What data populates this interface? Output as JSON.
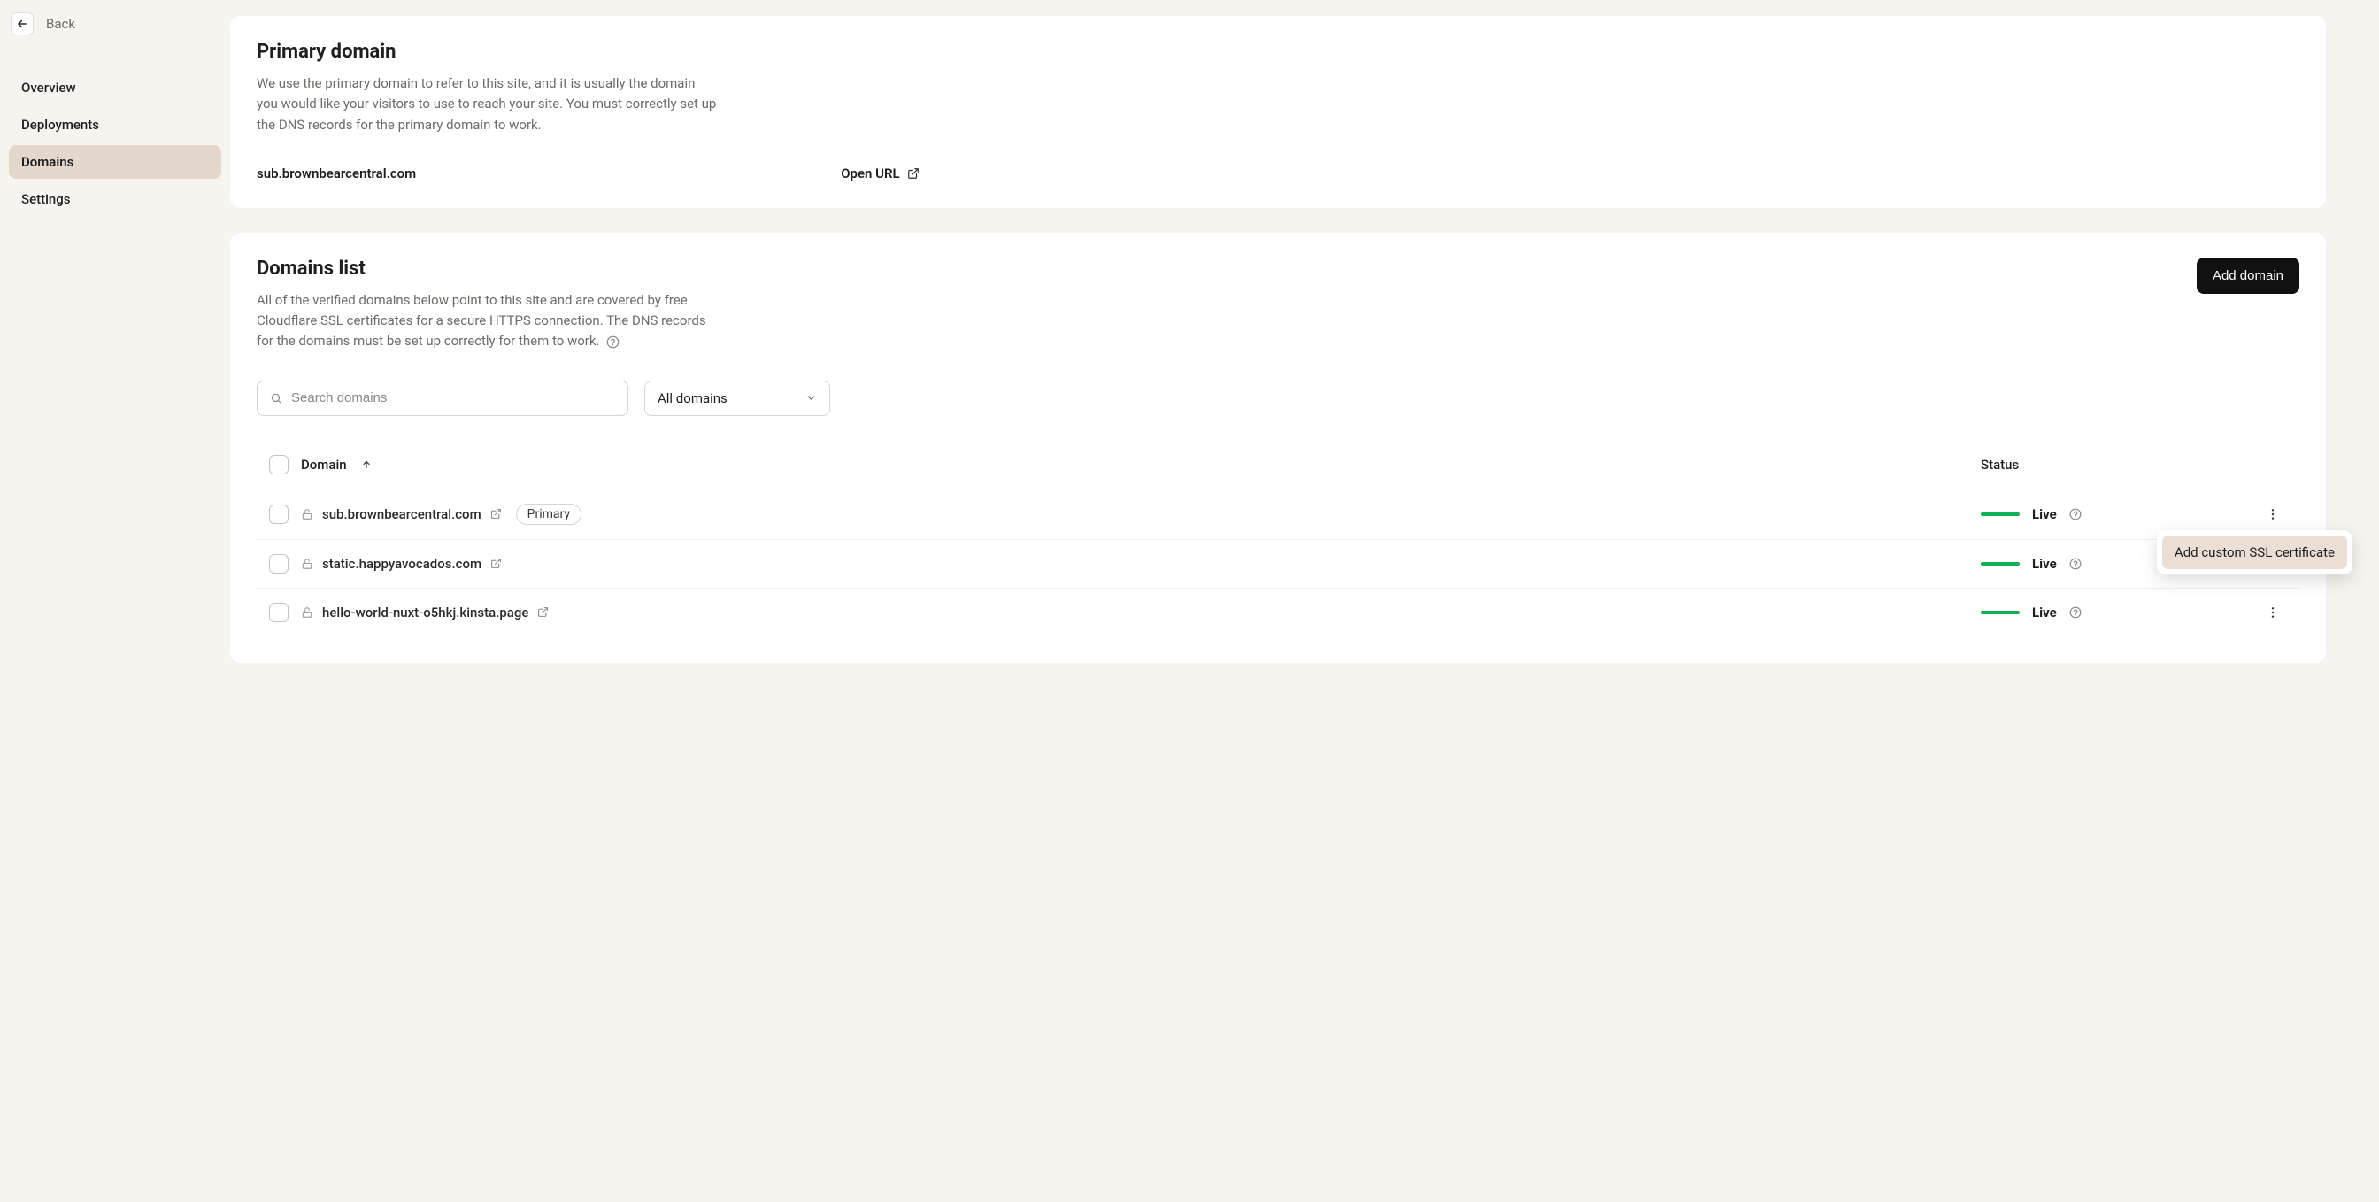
{
  "back": {
    "label": "Back"
  },
  "sidebar": {
    "items": [
      {
        "label": "Overview"
      },
      {
        "label": "Deployments"
      },
      {
        "label": "Domains"
      },
      {
        "label": "Settings"
      }
    ],
    "active_index": 2
  },
  "primary_card": {
    "title": "Primary domain",
    "description": "We use the primary domain to refer to this site, and it is usually the domain you would like your visitors to use to reach your site. You must correctly set up the DNS records for the primary domain to work.",
    "domain": "sub.brownbearcentral.com",
    "open_url_label": "Open URL"
  },
  "domains_card": {
    "title": "Domains list",
    "description": "All of the verified domains below point to this site and are covered by free Cloudflare SSL certificates for a secure HTTPS connection. The DNS records for the domains must be set up correctly for them to work.",
    "add_button": "Add domain",
    "search_placeholder": "Search domains",
    "filter_value": "All domains",
    "columns": {
      "domain": "Domain",
      "status": "Status"
    },
    "primary_badge": "Primary",
    "popup_item": "Add custom SSL certificate",
    "rows": [
      {
        "name": "sub.brownbearcentral.com",
        "status": "Live",
        "primary": true
      },
      {
        "name": "static.happyavocados.com",
        "status": "Live",
        "primary": false
      },
      {
        "name": "hello-world-nuxt-o5hkj.kinsta.page",
        "status": "Live",
        "primary": false
      }
    ]
  }
}
